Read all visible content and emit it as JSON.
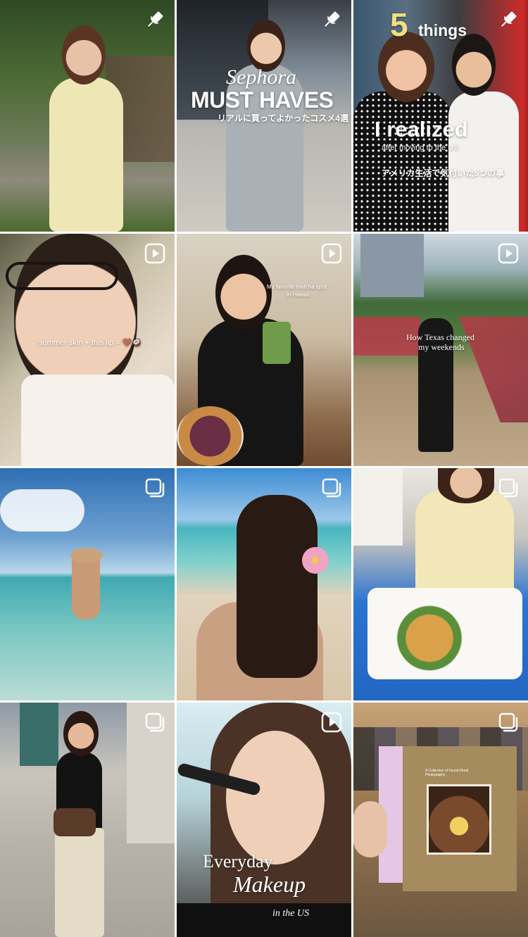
{
  "grid": {
    "posts": [
      {
        "type": "pinned",
        "badge_icon": "pin-icon"
      },
      {
        "type": "pinned",
        "badge_icon": "pin-icon",
        "overlay": {
          "line1": "Sephora",
          "line2": "MUST HAVES",
          "line3": "リアルに買ってよかったコスメ4選"
        }
      },
      {
        "type": "pinned",
        "badge_icon": "pin-icon",
        "overlay": {
          "number": "5",
          "word": "things",
          "line2": "I realized",
          "line3": "after moving to the US",
          "line4": "アメリカ生活で気付いた5つの事"
        }
      },
      {
        "type": "reel",
        "badge_icon": "reel-icon",
        "overlay": {
          "caption": "summer skin + this lip = 🤎🥥"
        }
      },
      {
        "type": "reel",
        "badge_icon": "reel-icon",
        "overlay": {
          "line1": "My favorite matcha spot",
          "line2": "in Hawaii"
        }
      },
      {
        "type": "reel",
        "badge_icon": "reel-icon",
        "overlay": {
          "line1": "How Texas changed",
          "line2": "my weekends"
        }
      },
      {
        "type": "carousel",
        "badge_icon": "carousel-icon"
      },
      {
        "type": "carousel",
        "badge_icon": "carousel-icon"
      },
      {
        "type": "carousel",
        "badge_icon": "carousel-icon"
      },
      {
        "type": "carousel",
        "badge_icon": "carousel-icon"
      },
      {
        "type": "reel",
        "badge_icon": "reel-icon",
        "overlay": {
          "line1": "Everyday",
          "line2": "Makeup",
          "line3": "in the US"
        }
      },
      {
        "type": "carousel",
        "badge_icon": "carousel-icon",
        "overlay": {
          "book": "A Collection of Found Floral Photography"
        }
      }
    ]
  }
}
